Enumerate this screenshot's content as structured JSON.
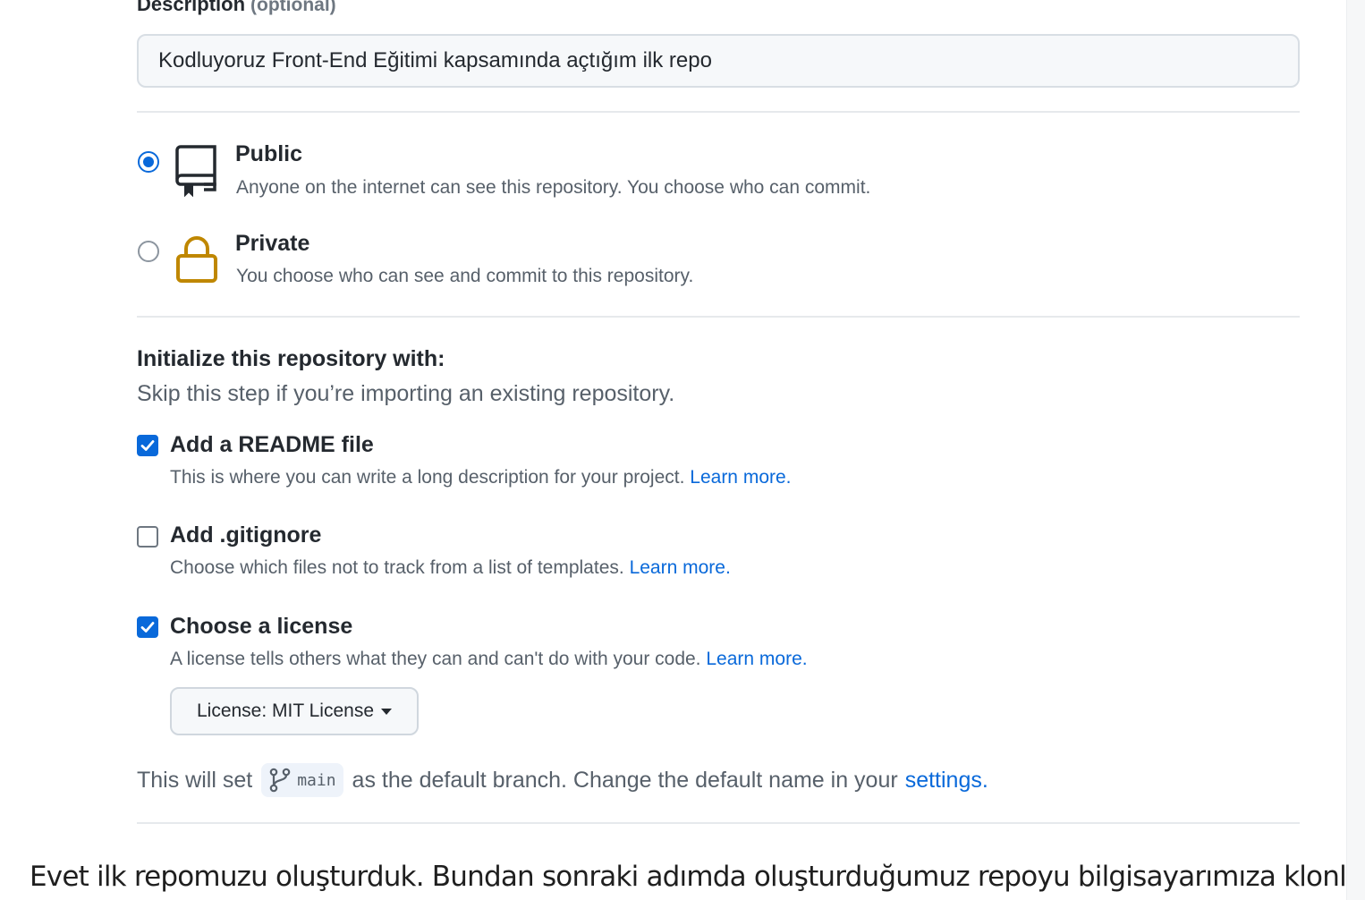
{
  "description": {
    "label": "Description",
    "optional_label": "(optional)",
    "value": "Kodluyoruz Front-End Eğitimi kapsamında açtığım ilk repo"
  },
  "visibility": {
    "public": {
      "title": "Public",
      "description": "Anyone on the internet can see this repository. You choose who can commit.",
      "selected": true,
      "icon": "repo-icon"
    },
    "private": {
      "title": "Private",
      "description": "You choose who can see and commit to this repository.",
      "selected": false,
      "icon": "lock-icon",
      "icon_color": "#bf8700"
    }
  },
  "initialize": {
    "title": "Initialize this repository with:",
    "subtitle": "Skip this step if you’re importing an existing repository.",
    "options": [
      {
        "label": "Add a README file",
        "description": "This is where you can write a long description for your project.",
        "link": "Learn more.",
        "checked": true
      },
      {
        "label": "Add .gitignore",
        "description": "Choose which files not to track from a list of templates.",
        "link": "Learn more.",
        "checked": false
      },
      {
        "label": "Choose a license",
        "description": "A license tells others what they can and can't do with your code.",
        "link": "Learn more.",
        "checked": true
      }
    ],
    "license_button": "License: MIT License"
  },
  "branch": {
    "prefix": "This will set",
    "name": "main",
    "middle": "as the default branch. Change the default name in your",
    "settings_link": "settings",
    "suffix": "."
  },
  "article": {
    "text": "Evet ilk repomuzu oluşturduk. Bundan sonraki adımda oluşturduğumuz repoyu bilgisayarımıza klonlamak"
  },
  "colors": {
    "accent": "#0969da",
    "lock": "#bf8700"
  }
}
